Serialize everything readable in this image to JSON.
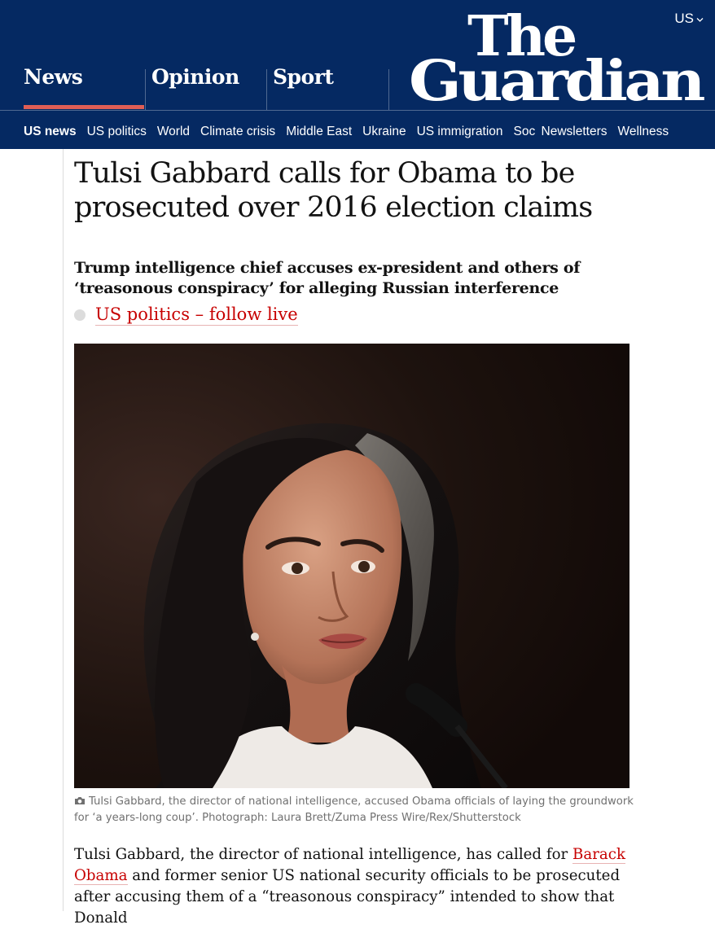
{
  "header": {
    "edition": "US",
    "logo_text": [
      "The",
      "Guardian"
    ],
    "pillars": [
      "News",
      "Opinion",
      "Sport"
    ],
    "active_pillar": "News",
    "subnav": [
      "US news",
      "US politics",
      "World",
      "Climate crisis",
      "Middle East",
      "Ukraine",
      "US immigration",
      "Soc",
      "Newsletters",
      "Wellness"
    ],
    "colors": {
      "brand": "#052962",
      "news_accent": "#e05e55",
      "link_red": "#c70000"
    }
  },
  "article": {
    "headline": "Tulsi Gabbard calls for Obama to be prosecuted over 2016 election claims",
    "standfirst": "Trump intelligence chief accuses ex-president and others of ‘treasonous conspiracy’ for alleging Russian interference",
    "live_link": "US politics – follow live",
    "caption": "Tulsi Gabbard, the director of national intelligence, accused Obama officials of laying the groundwork for ‘a years-long coup’. Photograph: Laura Brett/Zuma Press Wire/Rex/Shutterstock",
    "caption_icon": "camera-icon",
    "body": {
      "before_link": "Tulsi Gabbard, the director of national intelligence, has called for ",
      "link": "Barack Obama",
      "after_link": " and former senior US national security officials to be prosecuted after accusing them of a “treasonous conspiracy” intended to show that Donald"
    }
  }
}
